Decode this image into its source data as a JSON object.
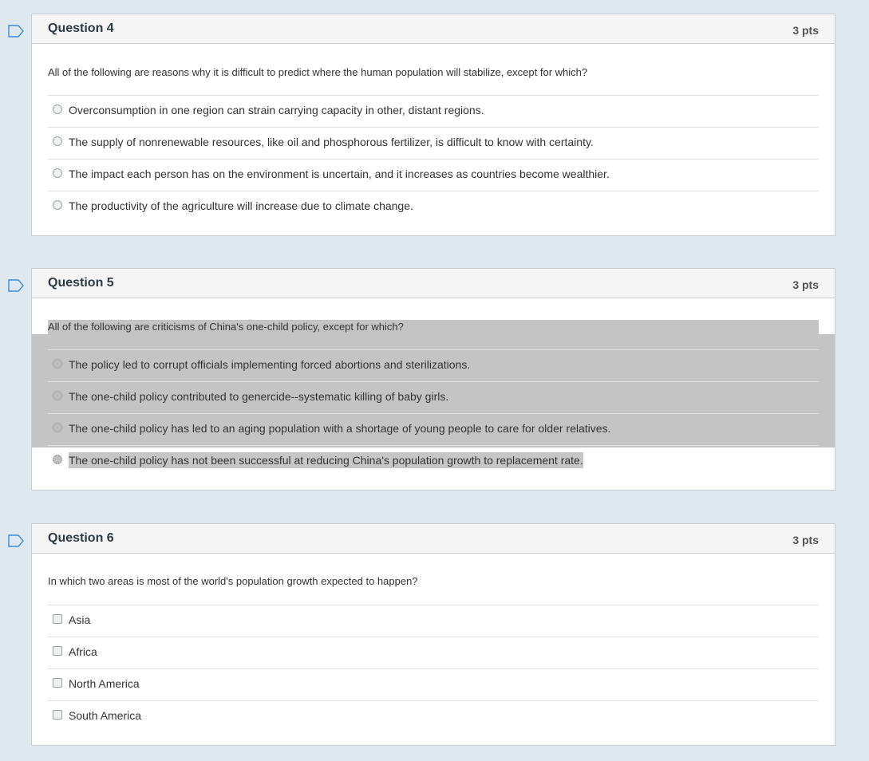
{
  "questions": [
    {
      "title": "Question 4",
      "points": "3 pts",
      "prompt": "All of the following are reasons why it is difficult to predict where the human population will stabilize, except for which?",
      "type": "radio",
      "options": [
        "Overconsumption in one region can strain carrying capacity in other, distant regions.",
        "The supply of nonrenewable resources, like oil and phosphorous fertilizer, is difficult to know with certainty.",
        "The impact each person has on the environment is uncertain, and it increases as countries become wealthier.",
        "The productivity of the agriculture will increase due to climate change."
      ]
    },
    {
      "title": "Question 5",
      "points": "3 pts",
      "prompt": "All of the following are criticisms of China's one-child policy, except for which?",
      "type": "radio",
      "text_selected": true,
      "options": [
        "The policy led to corrupt officials implementing forced abortions and sterilizations.",
        "The one-child policy contributed to genercide--systematic killing of baby girls.",
        "The one-child policy has led to an aging population with a shortage of young people to care for older relatives.",
        "The one-child policy has not been successful at reducing China's population growth to replacement rate."
      ]
    },
    {
      "title": "Question 6",
      "points": "3 pts",
      "prompt": "In which two areas is most of the world's population growth expected to happen?",
      "type": "checkbox",
      "options": [
        "Asia",
        "Africa",
        "North America",
        "South America"
      ]
    }
  ],
  "colors": {
    "page_bg": "#dfe8ef",
    "flag_stroke": "#3a8ed8",
    "selection": "#c4c4c4"
  },
  "icons": {
    "flag": "bookmark-flag-icon"
  }
}
